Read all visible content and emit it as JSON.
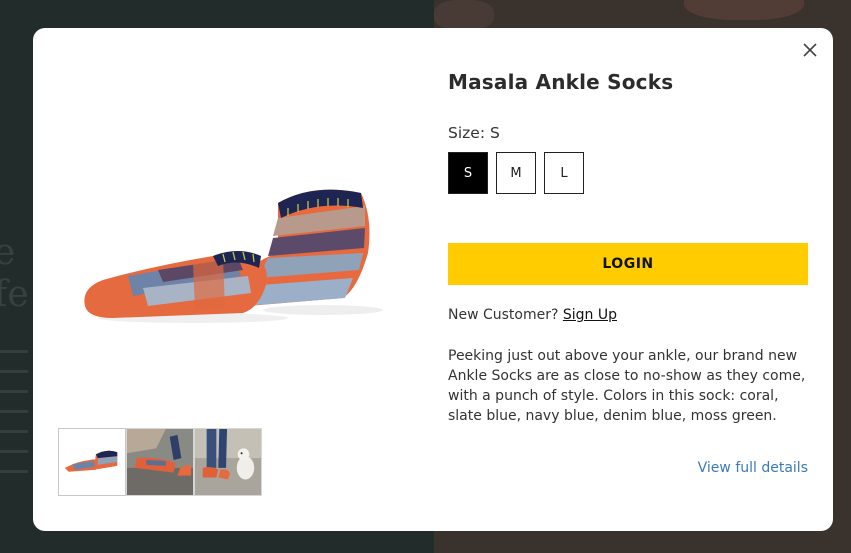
{
  "product": {
    "title": "Masala Ankle Socks",
    "size_label": "Size:",
    "selected_size": "S",
    "sizes": [
      "S",
      "M",
      "L"
    ],
    "description": "Peeking just out above your ankle, our brand new Ankle Socks are as close to no-show as they come, with a punch of style. Colors in this sock: coral, slate blue, navy blue, denim blue, moss green.",
    "view_details": "View full details"
  },
  "auth": {
    "login_label": "LOGIN",
    "new_customer_text": "New Customer?",
    "signup_label": "Sign Up"
  },
  "thumbnails": [
    {
      "name": "socks-product-photo"
    },
    {
      "name": "socks-on-feet-photo"
    },
    {
      "name": "socks-with-dog-photo"
    }
  ],
  "colors": {
    "accent": "#ffcc00",
    "link": "#3b7ab8",
    "selected_size_bg": "#000000"
  },
  "icons": {
    "close": "close-icon"
  }
}
